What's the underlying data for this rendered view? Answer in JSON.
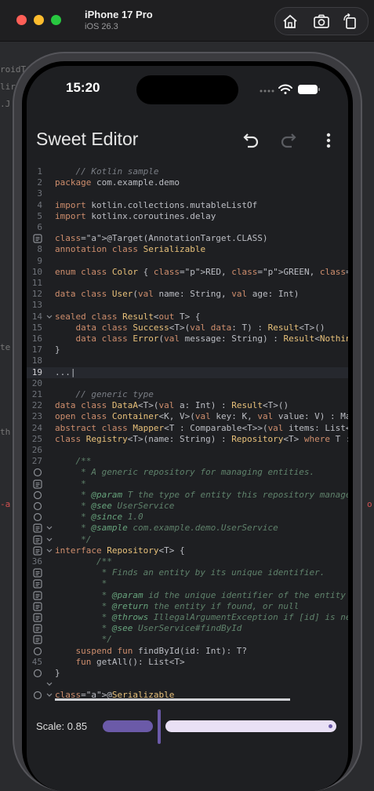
{
  "window": {
    "device_name": "iPhone 17 Pro",
    "os_version": "iOS 26.3",
    "traffic_colors": [
      "#ff5f57",
      "#febc2e",
      "#28c840"
    ],
    "tools": [
      "home-icon",
      "screenshot-icon",
      "rotate-icon"
    ]
  },
  "background_fragments": [
    "roidT",
    "lir",
    ".J",
    "te",
    "e",
    "th",
    "-a",
    "o"
  ],
  "status_bar": {
    "time": "15:20",
    "icons": [
      "signal-dots-icon",
      "wifi-icon",
      "battery-icon"
    ]
  },
  "app": {
    "title": "Sweet Editor",
    "toolbar": [
      "undo-icon",
      "redo-icon",
      "more-vert-icon"
    ]
  },
  "editor": {
    "current_line": "19",
    "lines": [
      {
        "n": "1",
        "g": "",
        "text": "    // Kotlin sample"
      },
      {
        "n": "2",
        "g": "",
        "text": "    package com.example.demo"
      },
      {
        "n": "3",
        "g": "",
        "text": ""
      },
      {
        "n": "4",
        "g": "",
        "text": "    import kotlin.collections.mutableListOf"
      },
      {
        "n": "5",
        "g": "",
        "text": "    import kotlinx.coroutines.delay"
      },
      {
        "n": "6",
        "g": "",
        "text": ""
      },
      {
        "n": "",
        "g": "doc",
        "text": "    @Target(AnnotationTarget.CLASS)"
      },
      {
        "n": "8",
        "g": "",
        "text": "    annotation class Serializable"
      },
      {
        "n": "9",
        "g": "",
        "text": ""
      },
      {
        "n": "10",
        "g": "",
        "text": "    enum class Color { RED, GREEN, BLUE }"
      },
      {
        "n": "11",
        "g": "",
        "text": ""
      },
      {
        "n": "12",
        "g": "",
        "text": "    data class User(val name: String, val age: Int)"
      },
      {
        "n": "13",
        "g": "",
        "text": ""
      },
      {
        "n": "14",
        "g": "fold",
        "text": "    sealed class Result<out T> {"
      },
      {
        "n": "15",
        "g": "",
        "text": "        data class Success<T>(val data: T) : Result<T>()"
      },
      {
        "n": "16",
        "g": "",
        "text": "        data class Error(val message: String) : Result<Nothing"
      },
      {
        "n": "17",
        "g": "",
        "text": "    }"
      },
      {
        "n": "18",
        "g": "",
        "text": ""
      },
      {
        "n": "19",
        "g": "",
        "text": "    ...|"
      },
      {
        "n": "20",
        "g": "",
        "text": ""
      },
      {
        "n": "21",
        "g": "",
        "text": "    // generic type"
      },
      {
        "n": "22",
        "g": "",
        "text": "    data class DataA<T>(val a: Int) : Result<T>()"
      },
      {
        "n": "23",
        "g": "",
        "text": "    open class Container<K, V>(val key: K, val value: V) : Map"
      },
      {
        "n": "24",
        "g": "",
        "text": "    abstract class Mapper<T : Comparable<T>>(val items: List<T"
      },
      {
        "n": "25",
        "g": "",
        "text": "    class Registry<T>(name: String) : Repository<T> where T :"
      },
      {
        "n": "26",
        "g": "",
        "text": ""
      },
      {
        "n": "27",
        "g": "",
        "text": "    /**"
      },
      {
        "n": "",
        "g": "circle",
        "text": "     * A generic repository for managing entities."
      },
      {
        "n": "",
        "g": "doc",
        "text": "     *"
      },
      {
        "n": "",
        "g": "circle",
        "text": "     * @param T the type of entity this repository manages"
      },
      {
        "n": "",
        "g": "circle",
        "text": "     * @see UserService"
      },
      {
        "n": "",
        "g": "circle",
        "text": "     * @since 1.0"
      },
      {
        "n": "",
        "g": "doc-fold",
        "text": "     * @sample com.example.demo.UserService"
      },
      {
        "n": "",
        "g": "doc-fold",
        "text": "     */"
      },
      {
        "n": "",
        "g": "doc-fold",
        "text": "    interface Repository<T> {"
      },
      {
        "n": "36",
        "g": "",
        "text": "        /**"
      },
      {
        "n": "",
        "g": "doc",
        "text": "         * Finds an entity by its unique identifier."
      },
      {
        "n": "",
        "g": "doc",
        "text": "         *"
      },
      {
        "n": "",
        "g": "doc",
        "text": "         * @param id the unique identifier of the entity"
      },
      {
        "n": "",
        "g": "doc",
        "text": "         * @return the entity if found, or null"
      },
      {
        "n": "",
        "g": "doc",
        "text": "         * @throws IllegalArgumentException if [id] is negati"
      },
      {
        "n": "",
        "g": "doc",
        "text": "         * @see UserService#findById"
      },
      {
        "n": "",
        "g": "doc",
        "text": "         */"
      },
      {
        "n": "",
        "g": "circle",
        "text": "        suspend fun findById(id: Int): T?"
      },
      {
        "n": "45",
        "g": "",
        "text": "        fun getAll(): List<T>"
      },
      {
        "n": "",
        "g": "circle",
        "text": "    }"
      },
      {
        "n": "",
        "g": "fold-empty",
        "text": ""
      },
      {
        "n": "",
        "g": "circle-fold",
        "text": "    @Serializable"
      }
    ]
  },
  "scale": {
    "label": "Scale: 0.85",
    "value": 0.85
  },
  "colors": {
    "accent": "#6b5aa8",
    "track": "#e9e0f5",
    "bg": "#1e1f22"
  }
}
